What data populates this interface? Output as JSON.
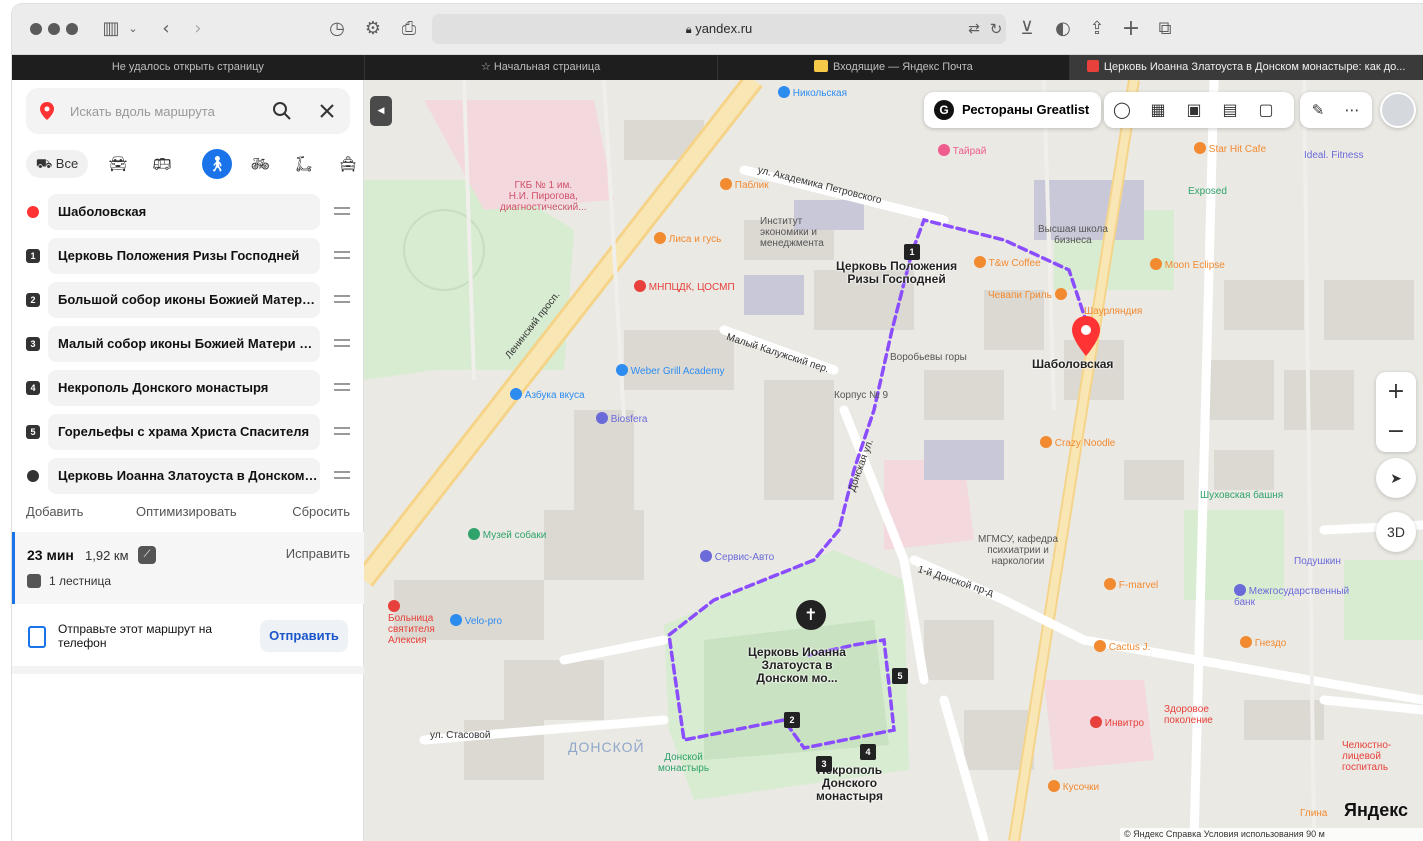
{
  "browser": {
    "url": "yandex.ru"
  },
  "tabs": [
    {
      "label": "Не удалось открыть страницу"
    },
    {
      "label": "Начальная страница"
    },
    {
      "label": "Входящие — Яндекс Почта"
    },
    {
      "label": "Церковь Иоанна Златоуста в Донском монастыре: как до..."
    }
  ],
  "panel": {
    "search_placeholder": "Искать вдоль маршрута",
    "mode_all_label": "Все",
    "stops": [
      {
        "marker": "",
        "label": "Шаболовская",
        "color": "#ff3333"
      },
      {
        "marker": "1",
        "label": "Церковь Положения Ризы Господней"
      },
      {
        "marker": "2",
        "label": "Большой собор иконы Божией Матери Донская"
      },
      {
        "marker": "3",
        "label": "Малый собор иконы Божией Матери Донская"
      },
      {
        "marker": "4",
        "label": "Некрополь Донского монастыря"
      },
      {
        "marker": "5",
        "label": "Горельефы с храма Христа Спасителя"
      },
      {
        "marker": "",
        "label": "Церковь Иоанна Златоуста в Донском монастыре",
        "color": "#333333"
      }
    ],
    "actions": {
      "add": "Добавить",
      "optimize": "Оптимизировать",
      "reset": "Сбросить"
    },
    "route": {
      "time": "23 мин",
      "distance": "1,92 км",
      "fix": "Исправить",
      "stairs": "1 лестница"
    },
    "send": {
      "text": "Отправьте этот маршрут на телефон",
      "button": "Отправить"
    }
  },
  "map": {
    "promo": "Рестораны Greatlist",
    "brand": "Яндекс",
    "copyright": "© Яндекс  Справка  Условия использования   90 м",
    "view3d": "3D",
    "zoom_in": "+",
    "zoom_out": "−",
    "labels": {
      "church_start": "Церковь Положения\nРизы Господней",
      "shabolovskaya": "Шаболовская",
      "church_end": "Церковь Иоанна\nЗлатоуста в\nДонском мо...",
      "necropolis": "Некрополь\nДонского\nмонастыря",
      "street1": "ул. Академика Петровского",
      "street2": "Ленинский просп.",
      "street3": "Малый Калужский пер.",
      "street4": "Донская ул.",
      "street5": "1-й Донской пр-д",
      "street6": "ул. Стасовой",
      "district": "ДОНСКОЙ",
      "hospital": "ГКБ № 1 им.\nН.И. Пирогова,\nдиагностический...",
      "institute": "Институт\nэкономики и\nменеджмента",
      "mgmsu": "МГМСУ, кафедра\nпсихиатрии и\nнаркологии",
      "school": "Высшая школа\nбизнеса",
      "tower": "Шуховская башня",
      "donskoy_monastery": "Донской\nмонастырь"
    },
    "pois": [
      {
        "name": "Никольская",
        "color": "#2d8cf0"
      },
      {
        "name": "Тайрай",
        "color": "#ee5d8d"
      },
      {
        "name": "Паблик",
        "color": "#f28a30"
      },
      {
        "name": "Лиса и гусь",
        "color": "#f28a30"
      },
      {
        "name": "МНПЦДК, ЦОСМП",
        "color": "#e8403a"
      },
      {
        "name": "Weber Grill Academy",
        "color": "#2d8cf0"
      },
      {
        "name": "Азбука вкуса",
        "color": "#2d8cf0"
      },
      {
        "name": "Biosfera",
        "color": "#6a6ad9"
      },
      {
        "name": "Музей собаки",
        "color": "#2fa36b"
      },
      {
        "name": "Сервис-Авто",
        "color": "#6a6ad9"
      },
      {
        "name": "Velo-pro",
        "color": "#2d8cf0"
      },
      {
        "name": "Больница святителя Алексия",
        "color": "#e8403a"
      },
      {
        "name": "T&w Coffee",
        "color": "#f28a30"
      },
      {
        "name": "Чевапи Гриль",
        "color": "#f28a30"
      },
      {
        "name": "Шаурляндия",
        "color": "#f28a30"
      },
      {
        "name": "Воробьевы горы",
        "color": "#8a8a8a"
      },
      {
        "name": "Корпус № 9",
        "color": "#8a8a8a"
      },
      {
        "name": "Crazy Noodle",
        "color": "#f28a30"
      },
      {
        "name": "Moon Eclipse",
        "color": "#f28a30"
      },
      {
        "name": "Star Hit Cafe",
        "color": "#f28a30"
      },
      {
        "name": "Ideal. Fitness",
        "color": "#6a6ad9"
      },
      {
        "name": "Exposed",
        "color": "#2fa36b"
      },
      {
        "name": "F-marvel",
        "color": "#f28a30"
      },
      {
        "name": "Межгосударственный банк",
        "color": "#6a6ad9"
      },
      {
        "name": "Cactus J.",
        "color": "#f28a30"
      },
      {
        "name": "Гнездо",
        "color": "#f28a30"
      },
      {
        "name": "Инвитро",
        "color": "#e8403a"
      },
      {
        "name": "Здоровое поколение",
        "color": "#e8403a"
      },
      {
        "name": "Кусочки",
        "color": "#f28a30"
      },
      {
        "name": "Подушкин",
        "color": "#6a6ad9"
      },
      {
        "name": "Челюстно-лицевой госпиталь",
        "color": "#e8403a"
      },
      {
        "name": "Глина",
        "color": "#f28a30"
      }
    ],
    "route_color": "#8a4dff"
  }
}
